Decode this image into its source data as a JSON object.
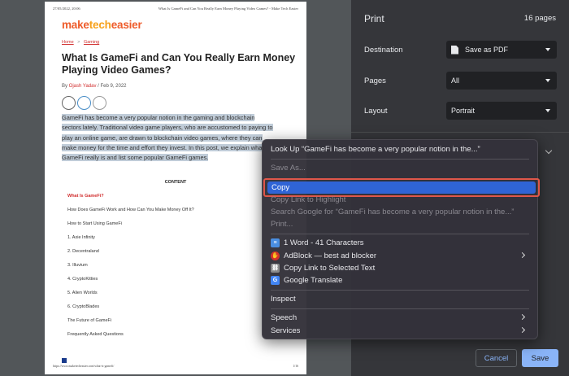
{
  "preview": {
    "header_left": "27/05/2022, 20:06",
    "header_center": "What Is GameFi and Can You Really Earn Money Playing Video Games? - Make Tech Easier",
    "logo_part1": "make",
    "logo_part2": "tech",
    "logo_part3": "easier",
    "breadcrumb_home": "Home",
    "breadcrumb_sep": ">",
    "breadcrumb_category": "Gaming",
    "title": "What Is GameFi and Can You Really Earn Money Playing Video Games?",
    "byline_prefix": "By ",
    "author": "Ojash Yadav",
    "date": " / Feb 9, 2022",
    "intro_lines": [
      "GameFi has become a very popular notion in the gaming and blockchain",
      "sectors lately. Traditional video game players, who are accustomed to paying to",
      "play an online game, are drawn to blockchain video games, where they can",
      "make money for the time and effort they invest. In this post, we explain what",
      "GameFi really is and list some popular GameFi games."
    ],
    "content_heading": "CONTENT",
    "toc": [
      "What Is GameFi?",
      "How Does GameFi Work and How Can You Make Money Off It?",
      "How to Start Using GameFi",
      "1. Axie Infinity",
      "2. Decentraland",
      "3. Illuvium",
      "4. CryptoKitties",
      "5. Alien Worlds",
      "6. CryptoBlades",
      "The Future of GameFi",
      "Frequently Asked Questions"
    ],
    "footer_url": "https://www.maketecheasier.com/what-is-gamefi/",
    "footer_page": "1/16"
  },
  "panel": {
    "title": "Print",
    "pages_count": "16 pages",
    "destination_label": "Destination",
    "destination_value": "Save as PDF",
    "pages_label": "Pages",
    "pages_value": "All",
    "layout_label": "Layout",
    "layout_value": "Portrait",
    "cancel_label": "Cancel",
    "save_label": "Save"
  },
  "context_menu": {
    "look_up": "Look Up “GameFi has become a very popular notion in the...”",
    "save_as": "Save As...",
    "copy": "Copy",
    "copy_link_highlight": "Copy Link to Highlight",
    "search_google": "Search Google for “GameFi has become a very popular notion in the...”",
    "print": "Print...",
    "word_count": "1 Word - 41 Characters",
    "adblock": "AdBlock — best ad blocker",
    "copy_link_selected": "Copy Link to Selected Text",
    "google_translate": "Google Translate",
    "inspect": "Inspect",
    "speech": "Speech",
    "services": "Services"
  },
  "colors": {
    "accent_blue": "#8ab4f8",
    "menu_highlight": "#2f64d6",
    "annotation_red": "#e0574a"
  }
}
